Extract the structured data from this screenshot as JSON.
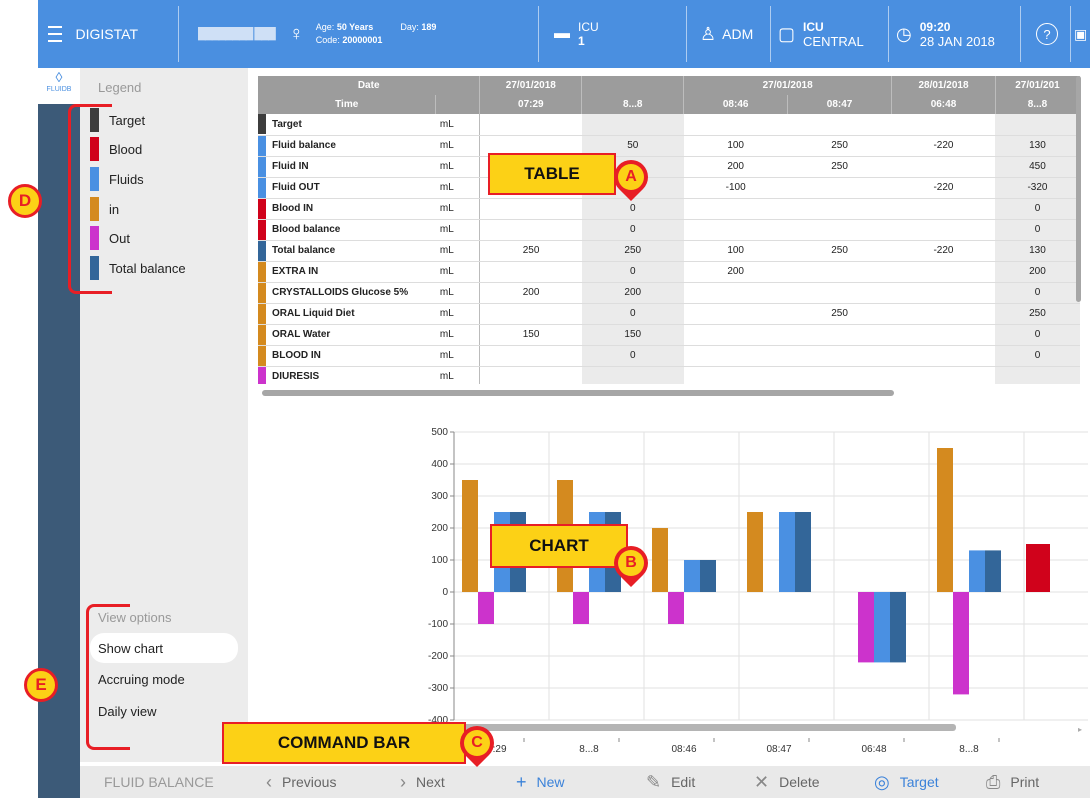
{
  "header": {
    "app_name": "DIGISTAT",
    "patient_name": "████████ ███",
    "age_label": "Age:",
    "age_value": "50 Years",
    "code_label": "Code:",
    "code_value": "20000001",
    "day_label": "Day:",
    "day_value": "189",
    "bed_ward": "ICU",
    "bed_number": "1",
    "user": "ADM",
    "workstation_line1": "ICU",
    "workstation_line2": "CENTRAL",
    "time": "09:20",
    "date": "28 JAN 2018",
    "help": "?"
  },
  "rail": {
    "tab_label": "FLUIDB"
  },
  "legend": {
    "title": "Legend",
    "items": [
      {
        "label": "Target",
        "color": "#3d3d3d"
      },
      {
        "label": "Blood",
        "color": "#d0021b"
      },
      {
        "label": "Fluids",
        "color": "#4a90e2"
      },
      {
        "label": "in",
        "color": "#d48a1f"
      },
      {
        "label": "Out",
        "color": "#cc33cc"
      },
      {
        "label": "Total balance",
        "color": "#336699"
      }
    ]
  },
  "view_options": {
    "title": "View options",
    "items": [
      {
        "label": "Show chart",
        "active": true
      },
      {
        "label": "Accruing mode",
        "active": false
      },
      {
        "label": "Daily view",
        "active": false
      }
    ]
  },
  "table": {
    "dates": [
      "27/01/2018",
      "",
      "27/01/2018",
      "",
      "28/01/2018",
      "27/01/201"
    ],
    "header_date": "Date",
    "header_time": "Time",
    "times": [
      "07:29",
      "8...8",
      "08:46",
      "08:47",
      "06:48",
      "8...8"
    ],
    "rows": [
      {
        "label": "Target",
        "unit": "mL",
        "color": "#3d3d3d",
        "values": [
          "",
          "",
          "",
          "",
          "",
          ""
        ]
      },
      {
        "label": "Fluid balance",
        "unit": "mL",
        "color": "#4a90e2",
        "values": [
          "",
          "50",
          "100",
          "250",
          "-220",
          "130"
        ]
      },
      {
        "label": "Fluid IN",
        "unit": "mL",
        "color": "#4a90e2",
        "values": [
          "",
          "",
          "200",
          "250",
          "",
          "450"
        ]
      },
      {
        "label": "Fluid OUT",
        "unit": "mL",
        "color": "#4a90e2",
        "values": [
          "",
          "",
          "-100",
          "",
          "-220",
          "-320"
        ]
      },
      {
        "label": "Blood IN",
        "unit": "mL",
        "color": "#d0021b",
        "values": [
          "",
          "0",
          "",
          "",
          "",
          "0"
        ]
      },
      {
        "label": "Blood balance",
        "unit": "mL",
        "color": "#d0021b",
        "values": [
          "",
          "0",
          "",
          "",
          "",
          "0"
        ]
      },
      {
        "label": "Total balance",
        "unit": "mL",
        "color": "#336699",
        "values": [
          "250",
          "250",
          "100",
          "250",
          "-220",
          "130"
        ]
      },
      {
        "label": "EXTRA IN",
        "unit": "mL",
        "color": "#d48a1f",
        "values": [
          "",
          "0",
          "200",
          "",
          "",
          "200"
        ]
      },
      {
        "label": "CRYSTALLOIDS Glucose 5%",
        "unit": "mL",
        "color": "#d48a1f",
        "values": [
          "200",
          "200",
          "",
          "",
          "",
          "0"
        ]
      },
      {
        "label": "ORAL Liquid Diet",
        "unit": "mL",
        "color": "#d48a1f",
        "values": [
          "",
          "0",
          "",
          "250",
          "",
          "250"
        ]
      },
      {
        "label": "ORAL Water",
        "unit": "mL",
        "color": "#d48a1f",
        "values": [
          "150",
          "150",
          "",
          "",
          "",
          "0"
        ]
      },
      {
        "label": "BLOOD IN",
        "unit": "mL",
        "color": "#d48a1f",
        "values": [
          "",
          "0",
          "",
          "",
          "",
          "0"
        ]
      },
      {
        "label": "DIURESIS",
        "unit": "mL",
        "color": "#cc33cc",
        "values": [
          "",
          "",
          "",
          "",
          "",
          ""
        ]
      }
    ]
  },
  "chart_data": {
    "type": "bar",
    "categories": [
      "07:29",
      "8...8",
      "08:46",
      "08:47",
      "06:48",
      "8...8",
      "("
    ],
    "series": [
      {
        "name": "in",
        "color": "#d48a1f",
        "values": [
          350,
          350,
          200,
          250,
          0,
          450,
          0
        ]
      },
      {
        "name": "Out",
        "color": "#cc33cc",
        "values": [
          -100,
          -100,
          -100,
          0,
          -220,
          -320,
          0
        ]
      },
      {
        "name": "Fluids",
        "color": "#4a90e2",
        "values": [
          250,
          250,
          100,
          250,
          -220,
          130,
          0
        ]
      },
      {
        "name": "Total balance",
        "color": "#336699",
        "values": [
          250,
          250,
          100,
          250,
          -220,
          130,
          0
        ]
      },
      {
        "name": "Blood",
        "color": "#d0021b",
        "values": [
          0,
          0,
          0,
          0,
          0,
          0,
          150
        ]
      }
    ],
    "ylim": [
      -400,
      500
    ],
    "yticks": [
      "500",
      "400",
      "300",
      "200",
      "100",
      "0",
      "-100",
      "-200",
      "-300",
      "-400"
    ],
    "grid": true,
    "legend": "left panel"
  },
  "command_bar": {
    "title": "FLUID BALANCE",
    "previous": "Previous",
    "next": "Next",
    "new": "New",
    "edit": "Edit",
    "delete": "Delete",
    "target": "Target",
    "print": "Print"
  },
  "annotations": {
    "table": "TABLE",
    "chart": "CHART",
    "command_bar": "COMMAND BAR",
    "a": "A",
    "b": "B",
    "c": "C",
    "d": "D",
    "e": "E"
  },
  "colors": {
    "header": "#4a8fe0",
    "rail": "#3c5a78",
    "accent": "#3b82d9",
    "callout": "#fcd116",
    "callout_border": "#e81e25"
  }
}
